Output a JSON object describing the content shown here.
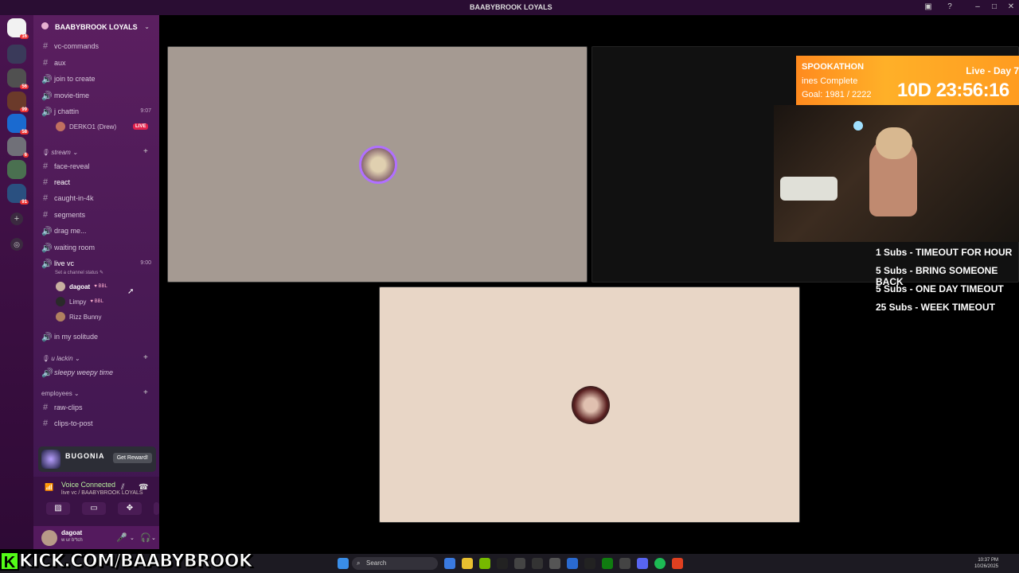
{
  "window": {
    "title": "BAABYBROOK LOYALS"
  },
  "servers": [
    {
      "badge": "16"
    },
    {
      "badge": ""
    },
    {
      "badge": "56"
    },
    {
      "badge": "99"
    },
    {
      "badge": "58"
    },
    {
      "badge": "6"
    },
    {
      "badge": ""
    },
    {
      "badge": "91"
    }
  ],
  "server": {
    "name": "BAABYBROOK LOYALS"
  },
  "channels": [
    {
      "type": "text",
      "name": "vc-commands"
    },
    {
      "type": "text",
      "name": "aux"
    },
    {
      "type": "voice",
      "name": "join to create"
    },
    {
      "type": "voice",
      "name": "movie-time"
    },
    {
      "type": "voice",
      "name": "j chattin",
      "time": "9:07"
    }
  ],
  "jchattin_member": {
    "name": "DERKO1 (Drew)",
    "badge": "LIVE"
  },
  "category_stream": {
    "name": "stream"
  },
  "stream_channels": [
    {
      "type": "text",
      "name": "face-reveal"
    },
    {
      "type": "text",
      "name": "react"
    },
    {
      "type": "text",
      "name": "caught-in-4k"
    },
    {
      "type": "text",
      "name": "segments"
    },
    {
      "type": "voice",
      "name": "drag me..."
    },
    {
      "type": "voice",
      "name": "waiting room"
    }
  ],
  "live_vc": {
    "name": "live vc",
    "time": "9:00",
    "status_hint": "Set a channel status"
  },
  "live_vc_members": [
    {
      "name": "dagoat",
      "tag": "BBL"
    },
    {
      "name": "Limpy",
      "tag": "BBL"
    },
    {
      "name": "Rizz Bunny",
      "tag": ""
    }
  ],
  "solitude": {
    "name": "in my solitude"
  },
  "category_ulackin": {
    "name": "u lackin"
  },
  "sleepy": {
    "name": "sleepy weepy time"
  },
  "category_employees": {
    "name": "employees"
  },
  "employee_channels": [
    {
      "type": "text",
      "name": "raw-clips"
    },
    {
      "type": "text",
      "name": "clips-to-post"
    }
  ],
  "reward": {
    "name": "BUGONIA",
    "button": "Get Reward!"
  },
  "voice": {
    "status": "Voice Connected",
    "sub": "live vc / BAABYBROOK LOYALS"
  },
  "user": {
    "name": "dagoat",
    "status": "w ur b*tch"
  },
  "overlay": {
    "title": "SPOOKATHON",
    "day": "Live - Day 7",
    "sub": "ines Complete",
    "goal": "Goal: 1981 / 2222",
    "timer": "10D 23:56:16"
  },
  "subs": [
    "1 Subs - TIMEOUT FOR HOUR",
    "5 Subs - BRING SOMEONE BACK",
    "5 Subs - ONE DAY TIMEOUT",
    "25 Subs - WEEK TIMEOUT"
  ],
  "taskbar": {
    "search": "Search",
    "time": "10:37 PM",
    "date": "10/26/2025"
  },
  "kick": {
    "logo": "K",
    "text": "KICK.COM/BAABYBROOK"
  },
  "colors": {
    "accent": "#ff8a1e",
    "kick_green": "#53fc18",
    "live_red": "#e2224d"
  }
}
